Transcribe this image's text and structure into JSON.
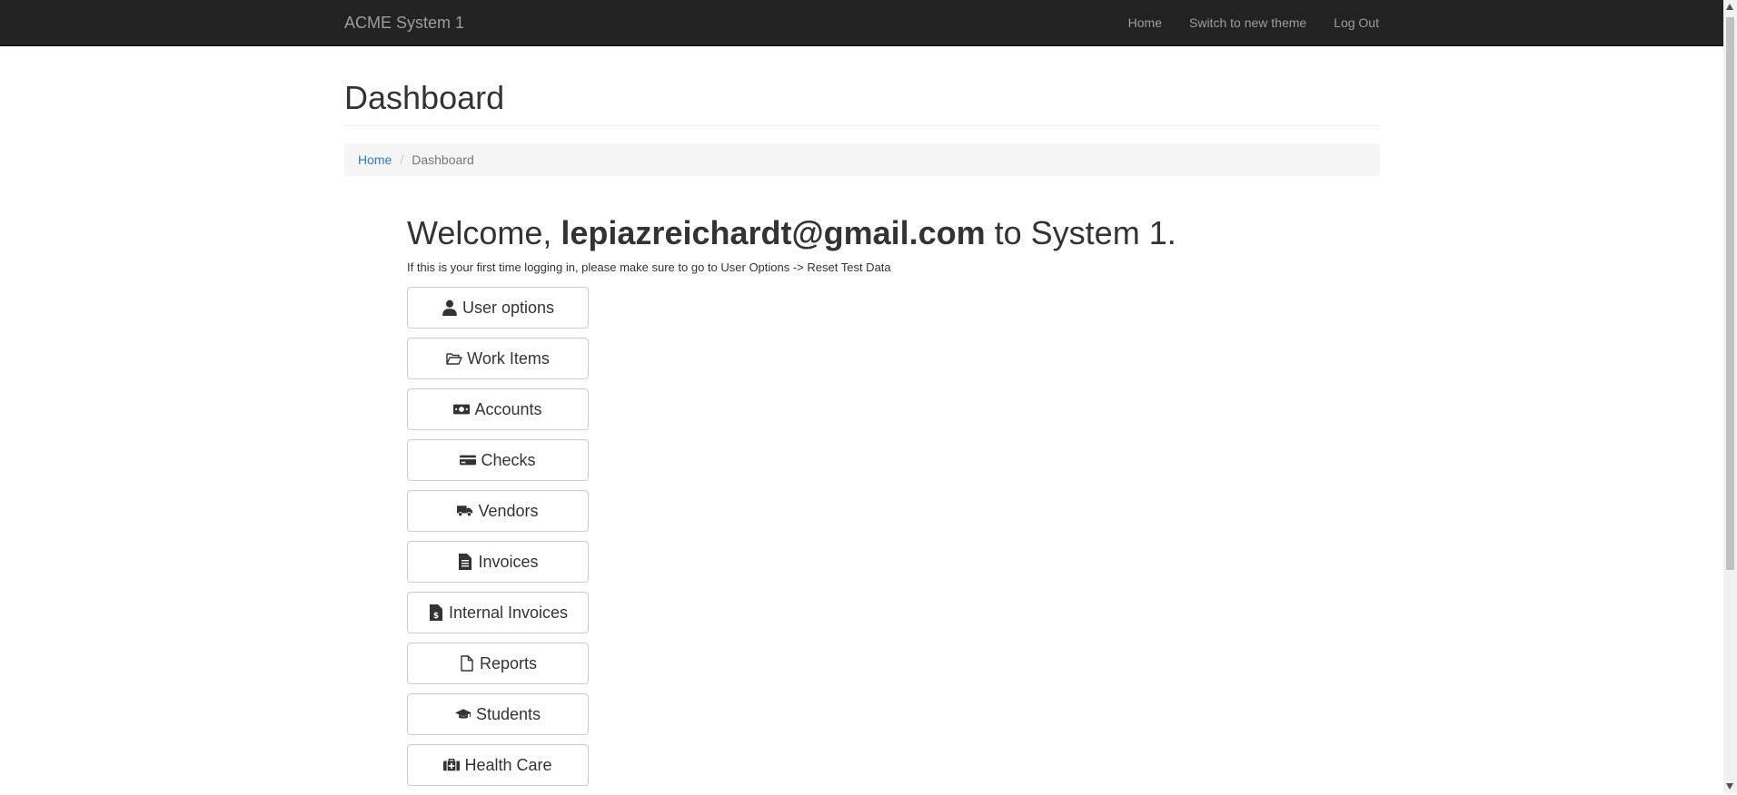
{
  "navbar": {
    "brand": "ACME System 1",
    "links": [
      {
        "label": "Home"
      },
      {
        "label": "Switch to new theme"
      },
      {
        "label": "Log Out"
      }
    ]
  },
  "page": {
    "title": "Dashboard"
  },
  "breadcrumb": {
    "home": "Home",
    "separator": "/",
    "current": "Dashboard"
  },
  "welcome": {
    "prefix": "Welcome, ",
    "user": "lepiazreichardt@gmail.com",
    "suffix": " to System 1.",
    "note": "If this is your first time logging in, please make sure to go to User Options -> Reset Test Data"
  },
  "menu": [
    {
      "label": "User options",
      "icon": "user-icon"
    },
    {
      "label": "Work Items",
      "icon": "folder-open-icon"
    },
    {
      "label": "Accounts",
      "icon": "money-bill-icon"
    },
    {
      "label": "Checks",
      "icon": "credit-card-icon"
    },
    {
      "label": "Vendors",
      "icon": "truck-icon"
    },
    {
      "label": "Invoices",
      "icon": "file-invoice-icon"
    },
    {
      "label": "Internal Invoices",
      "icon": "file-invoice-dollar-icon"
    },
    {
      "label": "Reports",
      "icon": "file-icon"
    },
    {
      "label": "Students",
      "icon": "graduation-cap-icon"
    },
    {
      "label": "Health Care",
      "icon": "medkit-icon"
    }
  ],
  "colors": {
    "navbar_bg": "#222222",
    "nav_text": "#9d9d9d",
    "link": "#337ab7",
    "breadcrumb_bg": "#f5f5f5"
  }
}
